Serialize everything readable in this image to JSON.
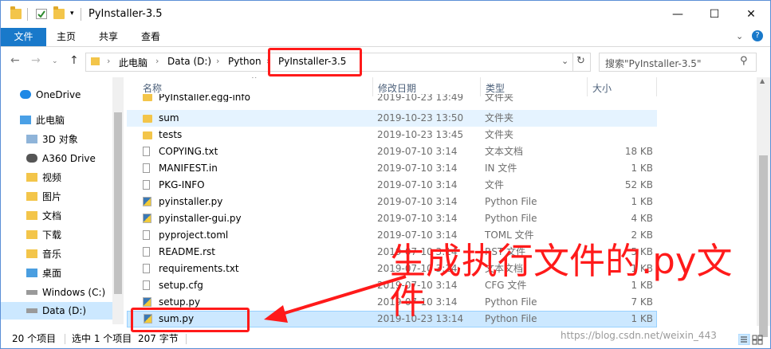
{
  "window": {
    "title": "PyInstaller-3.5",
    "controls": {
      "minimize": "—",
      "maximize": "☐",
      "close": "✕"
    }
  },
  "ribbon": {
    "tabs": [
      {
        "label": "文件"
      },
      {
        "label": "主页"
      },
      {
        "label": "共享"
      },
      {
        "label": "查看"
      }
    ]
  },
  "address_bar": {
    "crumbs": [
      "此电脑",
      "Data (D:)",
      "Python",
      "PyInstaller-3.5"
    ],
    "separator": "›"
  },
  "search": {
    "placeholder": "搜索\"PyInstaller-3.5\""
  },
  "nav_pane": {
    "items": [
      {
        "label": "OneDrive",
        "icon": "cloud-icon"
      },
      {
        "label": "此电脑",
        "icon": "computer-icon"
      },
      {
        "label": "3D 对象",
        "icon": "3d-objects-icon"
      },
      {
        "label": "A360 Drive",
        "icon": "a360-drive-icon"
      },
      {
        "label": "视频",
        "icon": "videos-icon"
      },
      {
        "label": "图片",
        "icon": "pictures-icon"
      },
      {
        "label": "文档",
        "icon": "documents-icon"
      },
      {
        "label": "下载",
        "icon": "downloads-icon"
      },
      {
        "label": "音乐",
        "icon": "music-icon"
      },
      {
        "label": "桌面",
        "icon": "desktop-icon"
      },
      {
        "label": "Windows (C:)",
        "icon": "drive-icon"
      },
      {
        "label": "Data (D:)",
        "icon": "drive-icon",
        "selected": true
      }
    ]
  },
  "columns": {
    "name": "名称",
    "date": "修改日期",
    "type": "类型",
    "size": "大小"
  },
  "files": [
    {
      "name": "PyInstaller.egg-info",
      "date": "2019-10-23 13:49",
      "type": "文件夹",
      "size": "",
      "icon": "folder-icon"
    },
    {
      "name": "sum",
      "date": "2019-10-23 13:50",
      "type": "文件夹",
      "size": "",
      "icon": "folder-icon"
    },
    {
      "name": "tests",
      "date": "2019-10-23 13:45",
      "type": "文件夹",
      "size": "",
      "icon": "folder-icon"
    },
    {
      "name": "COPYING.txt",
      "date": "2019-07-10 3:14",
      "type": "文本文档",
      "size": "18 KB",
      "icon": "text-file-icon"
    },
    {
      "name": "MANIFEST.in",
      "date": "2019-07-10 3:14",
      "type": "IN 文件",
      "size": "1 KB",
      "icon": "file-icon"
    },
    {
      "name": "PKG-INFO",
      "date": "2019-07-10 3:14",
      "type": "文件",
      "size": "52 KB",
      "icon": "file-icon"
    },
    {
      "name": "pyinstaller.py",
      "date": "2019-07-10 3:14",
      "type": "Python File",
      "size": "1 KB",
      "icon": "python-file-icon"
    },
    {
      "name": "pyinstaller-gui.py",
      "date": "2019-07-10 3:14",
      "type": "Python File",
      "size": "4 KB",
      "icon": "python-file-icon"
    },
    {
      "name": "pyproject.toml",
      "date": "2019-07-10 3:14",
      "type": "TOML 文件",
      "size": "2 KB",
      "icon": "file-icon"
    },
    {
      "name": "README.rst",
      "date": "2019-07-10 3:14",
      "type": "RST 文件",
      "size": "5 KB",
      "icon": "file-icon"
    },
    {
      "name": "requirements.txt",
      "date": "2019-07-10 3:14",
      "type": "文本文档",
      "size": "1 KB",
      "icon": "text-file-icon"
    },
    {
      "name": "setup.cfg",
      "date": "2019-07-10 3:14",
      "type": "CFG 文件",
      "size": "1 KB",
      "icon": "file-icon"
    },
    {
      "name": "setup.py",
      "date": "2019-07-10 3:14",
      "type": "Python File",
      "size": "7 KB",
      "icon": "python-file-icon"
    },
    {
      "name": "sum.py",
      "date": "2019-10-23 13:14",
      "type": "Python File",
      "size": "1 KB",
      "icon": "python-file-icon",
      "selected": true
    }
  ],
  "status_bar": {
    "item_count": "20 个项目",
    "selection": "选中 1 个项目",
    "selection_size": "207 字节"
  },
  "annotation": {
    "text": "生成执行文件的.py文件",
    "color": "#ff1a1a"
  },
  "watermark": "https://blog.csdn.net/weixin_443",
  "colors": {
    "accent": "#1979ca",
    "selection": "#cce8ff",
    "annotation": "#ff1a1a"
  }
}
